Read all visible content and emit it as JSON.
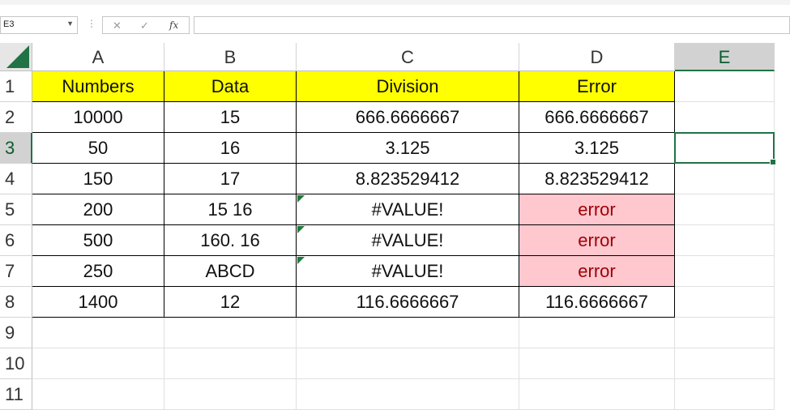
{
  "namebox": {
    "value": "E3"
  },
  "formula": {
    "fx_label": "fx",
    "value": ""
  },
  "columns": [
    "A",
    "B",
    "C",
    "D",
    "E"
  ],
  "rows": [
    "1",
    "2",
    "3",
    "4",
    "5",
    "6",
    "7",
    "8",
    "9",
    "10",
    "11"
  ],
  "selected_cell": "E3",
  "table": {
    "headers": [
      "Numbers",
      "Data",
      "Division",
      "Error"
    ],
    "body": [
      [
        "10000",
        "15",
        "666.6666667",
        "666.6666667"
      ],
      [
        "50",
        "16",
        "3.125",
        "3.125"
      ],
      [
        "150",
        "17",
        "8.823529412",
        "8.823529412"
      ],
      [
        "200",
        "15 16",
        "#VALUE!",
        "error"
      ],
      [
        "500",
        "160. 16",
        "#VALUE!",
        "error"
      ],
      [
        "250",
        "ABCD",
        "#VALUE!",
        "error"
      ],
      [
        "1400",
        "12",
        "116.6666667",
        "116.6666667"
      ]
    ]
  },
  "colors": {
    "header_fill": "#ffff00",
    "error_fill": "#ffc7ce",
    "error_text": "#9c0006",
    "selection": "#217346"
  }
}
